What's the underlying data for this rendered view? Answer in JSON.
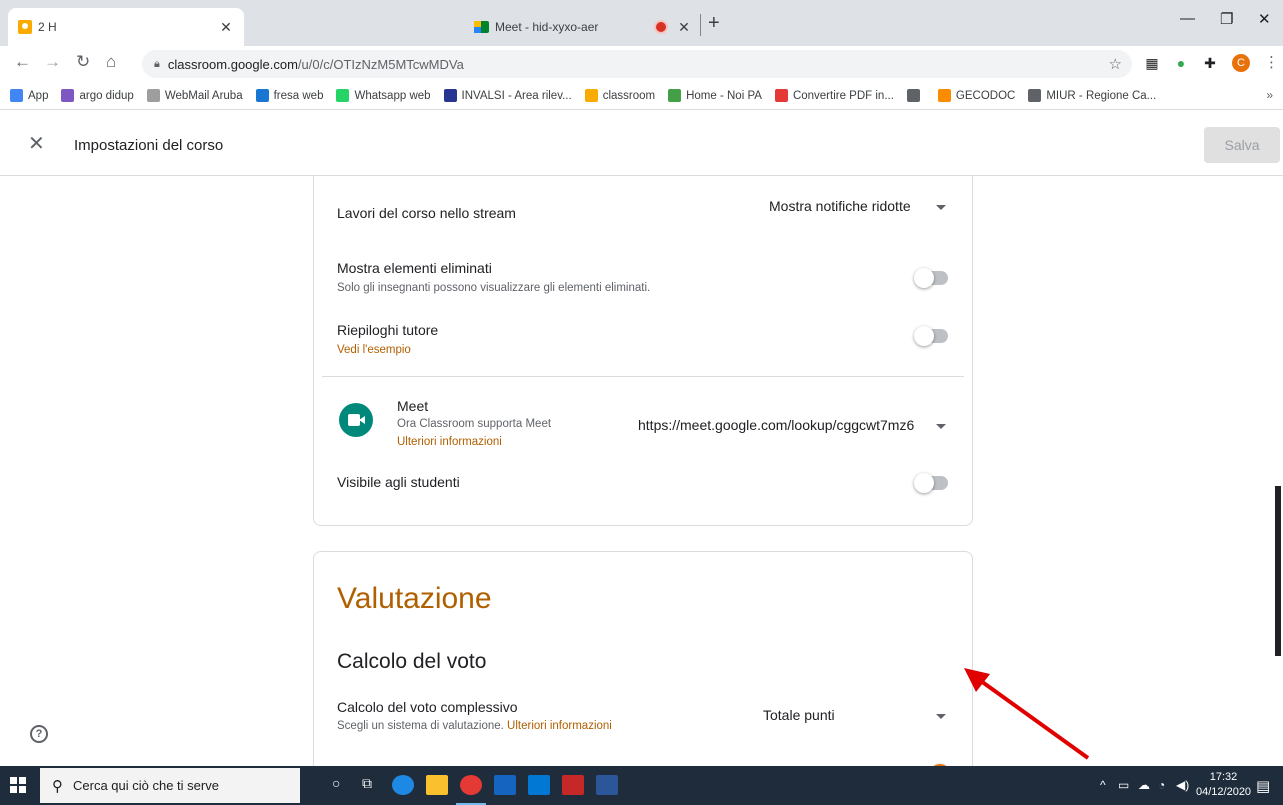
{
  "browser": {
    "tabs": [
      {
        "title": "2 H",
        "active": true
      },
      {
        "title": "Meet - hid-xyxo-aer",
        "active": false
      }
    ],
    "url_host": "classroom.google.com",
    "url_path": "/u/0/c/OTIzNzM5MTcwMDVa",
    "profile_initial": "C"
  },
  "bookmarks": [
    {
      "label": "App",
      "color": "#4285f4"
    },
    {
      "label": "argo didup",
      "color": "#7e57c2"
    },
    {
      "label": "WebMail Aruba",
      "color": "#9e9e9e"
    },
    {
      "label": "fresa web",
      "color": "#1976d2"
    },
    {
      "label": "Whatsapp web",
      "color": "#25d366"
    },
    {
      "label": "INVALSI - Area rilev...",
      "color": "#283593"
    },
    {
      "label": "classroom",
      "color": "#f9ab00"
    },
    {
      "label": "Home - Noi PA",
      "color": "#43a047"
    },
    {
      "label": "Convertire PDF in...",
      "color": "#e53935"
    },
    {
      "label": "",
      "color": "#5f6368"
    },
    {
      "label": "GECODOC",
      "color": "#fb8c00"
    },
    {
      "label": "MIUR - Regione Ca...",
      "color": "#5f6368"
    }
  ],
  "header": {
    "title": "Impostazioni del corso",
    "save_label": "Salva"
  },
  "general": {
    "stream_label": "Lavori del corso nello stream",
    "stream_value": "Mostra notifiche ridotte",
    "deleted_label": "Mostra elementi eliminati",
    "deleted_sub": "Solo gli insegnanti possono visualizzare gli elementi eliminati.",
    "deleted_on": false,
    "guardian_label": "Riepiloghi tutore",
    "guardian_link": "Vedi l'esempio",
    "guardian_on": false
  },
  "meet": {
    "title": "Meet",
    "sub": "Ora Classroom supporta Meet",
    "link": "Ulteriori informazioni",
    "url": "https://meet.google.com/lookup/cggcwt7mz6",
    "visible_label": "Visibile agli studenti",
    "visible_on": false
  },
  "grading": {
    "section_title": "Valutazione",
    "subsection_title": "Calcolo del voto",
    "overall_label": "Calcolo del voto complessivo",
    "overall_sub": "Scegli un sistema di valutazione.",
    "overall_link": "Ulteriori informazioni",
    "overall_value": "Totale punti"
  },
  "taskbar": {
    "search_placeholder": "Cerca qui ciò che ti serve",
    "time": "17:32",
    "date": "04/12/2020"
  },
  "colors": {
    "accent": "#b06000",
    "annotation_arrow": "#e00000"
  }
}
